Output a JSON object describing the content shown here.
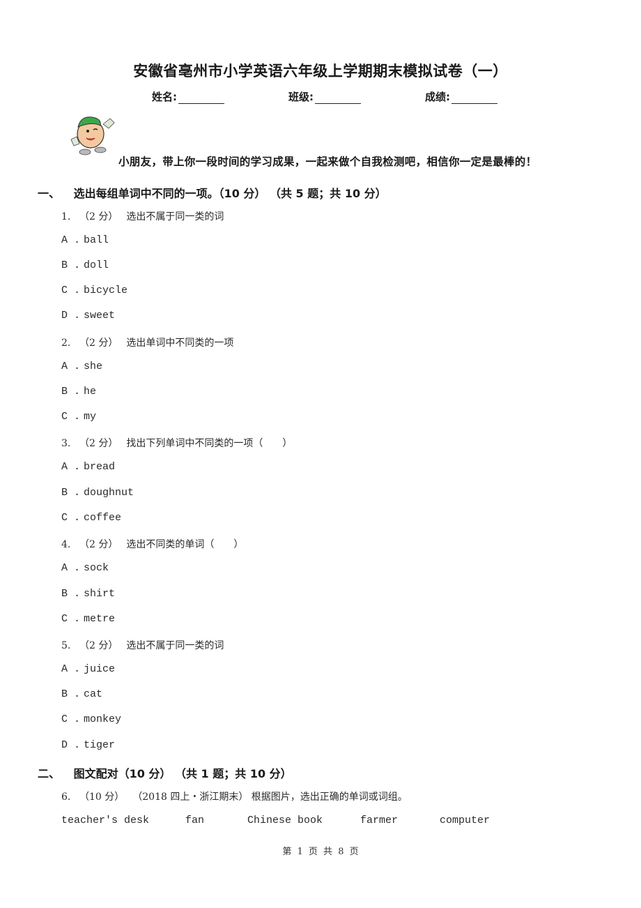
{
  "document": {
    "title": "安徽省亳州市小学英语六年级上学期期末模拟试卷（一）",
    "fields": [
      {
        "label": "姓名:"
      },
      {
        "label": "班级:"
      },
      {
        "label": "成绩:"
      }
    ],
    "mascot_icon": "cartoon-boy-mascot",
    "encouragement": "小朋友，带上你一段时间的学习成果，一起来做个自我检测吧，相信你一定是最棒的！",
    "sections": [
      {
        "number": "一、",
        "heading": "选出每组单词中不同的一项。（10 分） （共 5 题；共 10 分）",
        "questions": [
          {
            "number": "1.",
            "points": "（2 分）",
            "prompt": "选出不属于同一类的词",
            "options": [
              {
                "letter": "A .",
                "text": "ball"
              },
              {
                "letter": "B .",
                "text": "doll"
              },
              {
                "letter": "C .",
                "text": "bicycle"
              },
              {
                "letter": "D .",
                "text": "sweet"
              }
            ]
          },
          {
            "number": "2.",
            "points": "（2 分）",
            "prompt": "选出单词中不同类的一项",
            "options": [
              {
                "letter": "A .",
                "text": "she"
              },
              {
                "letter": "B .",
                "text": "he"
              },
              {
                "letter": "C .",
                "text": "my"
              }
            ]
          },
          {
            "number": "3.",
            "points": "（2 分）",
            "prompt": "找出下列单词中不同类的一项（　　）",
            "options": [
              {
                "letter": "A .",
                "text": "bread"
              },
              {
                "letter": "B .",
                "text": "doughnut"
              },
              {
                "letter": "C .",
                "text": "coffee"
              }
            ]
          },
          {
            "number": "4.",
            "points": "（2 分）",
            "prompt": "选出不同类的单词（　　）",
            "options": [
              {
                "letter": "A .",
                "text": "sock"
              },
              {
                "letter": "B .",
                "text": "shirt"
              },
              {
                "letter": "C .",
                "text": "metre"
              }
            ]
          },
          {
            "number": "5.",
            "points": "（2 分）",
            "prompt": "选出不属于同一类的词",
            "options": [
              {
                "letter": "A .",
                "text": "juice"
              },
              {
                "letter": "B .",
                "text": "cat"
              },
              {
                "letter": "C .",
                "text": "monkey"
              },
              {
                "letter": "D .",
                "text": "tiger"
              }
            ]
          }
        ]
      },
      {
        "number": "二、",
        "heading": "图文配对（10 分） （共 1 题；共 10 分）",
        "questions": [
          {
            "number": "6.",
            "points": "（10 分）",
            "prompt": "（2018 四上・浙江期末） 根据图片，选出正确的单词或词组。",
            "word_bank": [
              "teacher's desk",
              "fan",
              "Chinese book",
              "farmer",
              "computer"
            ]
          }
        ]
      }
    ],
    "footer": "第 1 页 共 8 页"
  }
}
